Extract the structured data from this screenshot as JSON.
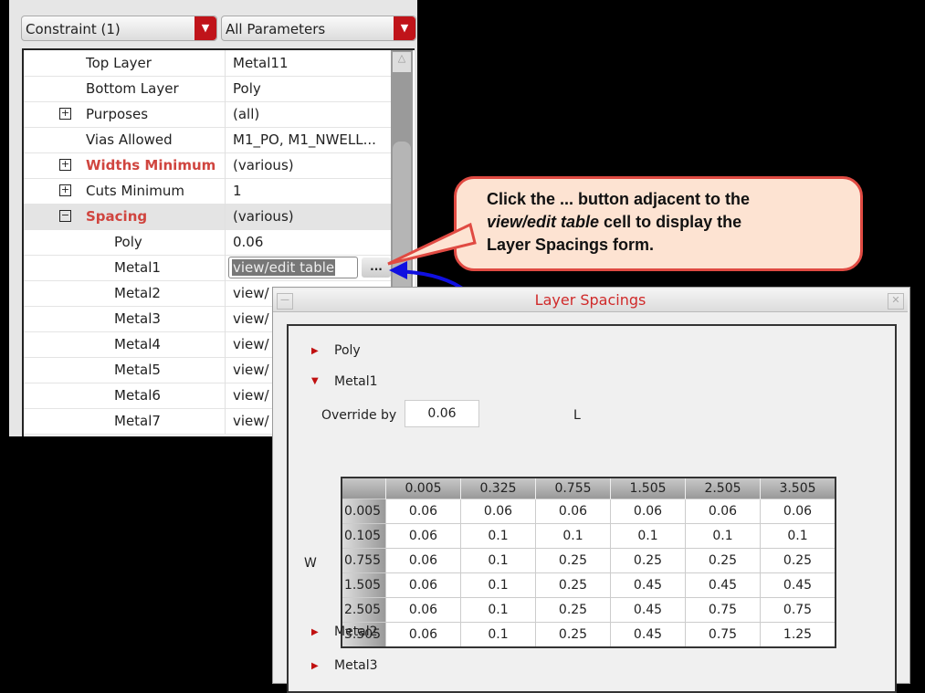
{
  "filters": {
    "constraint": "Constraint (1)",
    "params": "All Parameters"
  },
  "rows": [
    {
      "name": "Top Layer",
      "value": "Metal11"
    },
    {
      "name": "Bottom Layer",
      "value": "Poly"
    },
    {
      "name": "Purposes",
      "value": "(all)",
      "expander": "+"
    },
    {
      "name": "Vias Allowed",
      "value": "M1_PO, M1_NWELL..."
    },
    {
      "name": "Widths Minimum",
      "value": "(various)",
      "expander": "+"
    },
    {
      "name": "Cuts Minimum",
      "value": "1",
      "expander": "+"
    },
    {
      "name": "Spacing",
      "value": "(various)",
      "expander": "−"
    },
    {
      "name": "Poly",
      "value": "0.06"
    },
    {
      "name": "Metal1",
      "value": "view/edit table"
    },
    {
      "name": "Metal2",
      "value": "view/"
    },
    {
      "name": "Metal3",
      "value": "view/"
    },
    {
      "name": "Metal4",
      "value": "view/"
    },
    {
      "name": "Metal5",
      "value": "view/"
    },
    {
      "name": "Metal6",
      "value": "view/"
    },
    {
      "name": "Metal7",
      "value": "view/"
    }
  ],
  "ellipsis_button": "...",
  "callout": {
    "line1": "Click the ... button adjacent to the",
    "italic": "view/edit table",
    "line2rest": " cell to display the",
    "line3": "Layer Spacings form."
  },
  "dialog": {
    "title": "Layer Spacings",
    "layers": [
      "Poly",
      "Metal1",
      "Metal2",
      "Metal3"
    ],
    "override_label": "Override by",
    "override_value": "0.06",
    "l_label": "L",
    "w_label": "W",
    "col_headers": [
      "0.005",
      "0.325",
      "0.755",
      "1.505",
      "2.505",
      "3.505"
    ],
    "row_headers": [
      "0.005",
      "0.105",
      "0.755",
      "1.505",
      "2.505",
      "3.505"
    ],
    "cells": [
      [
        "0.06",
        "0.06",
        "0.06",
        "0.06",
        "0.06",
        "0.06"
      ],
      [
        "0.06",
        "0.1",
        "0.1",
        "0.1",
        "0.1",
        "0.1"
      ],
      [
        "0.06",
        "0.1",
        "0.25",
        "0.25",
        "0.25",
        "0.25"
      ],
      [
        "0.06",
        "0.1",
        "0.25",
        "0.45",
        "0.45",
        "0.45"
      ],
      [
        "0.06",
        "0.1",
        "0.25",
        "0.45",
        "0.75",
        "0.75"
      ],
      [
        "0.06",
        "0.1",
        "0.25",
        "0.45",
        "0.75",
        "1.25"
      ]
    ]
  }
}
